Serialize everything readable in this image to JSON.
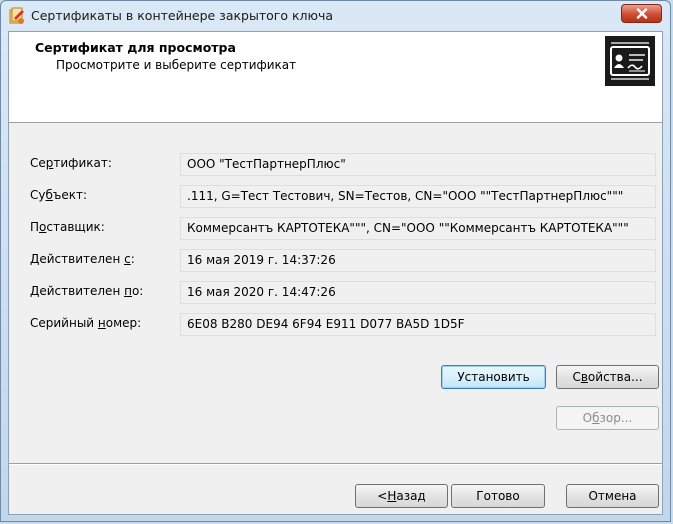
{
  "window": {
    "title": "Сертификаты в контейнере закрытого ключа"
  },
  "header": {
    "title": "Сертификат для просмотра",
    "subtitle": "Просмотрите и выберите сертификат"
  },
  "fields": [
    {
      "label_pre": "Се",
      "label_key": "р",
      "label_post": "тификат:",
      "value": "ООО \"ТестПартнерПлюс\""
    },
    {
      "label_pre": "Су",
      "label_key": "б",
      "label_post": "ъект:",
      "value": ".111, G=Тест Тестович, SN=Тестов, CN=\"ООО \"\"ТестПартнерПлюс\"\"\""
    },
    {
      "label_pre": "П",
      "label_key": "о",
      "label_post": "ставщик:",
      "value": "Коммерсантъ КАРТОТЕКА\"\"\", CN=\"ООО \"\"Коммерсантъ КАРТОТЕКА\"\"\""
    },
    {
      "label_pre": "Действителен ",
      "label_key": "с",
      "label_post": ":",
      "value": "16 мая 2019 г. 14:37:26"
    },
    {
      "label_pre": "Действителен ",
      "label_key": "п",
      "label_post": "о:",
      "value": "16 мая 2020 г. 14:47:26"
    },
    {
      "label_pre": "Серийный ",
      "label_key": "н",
      "label_post": "омер:",
      "value": "6E08 B280 DE94 6F94 E911 D077 BA5D 1D5F"
    }
  ],
  "buttons": {
    "install": "Установить",
    "properties_pre": "С",
    "properties_key": "в",
    "properties_post": "ойства...",
    "browse_pre": "О",
    "browse_key": "б",
    "browse_post": "зор...",
    "back_pre": "< ",
    "back_key": "Н",
    "back_post": "азад",
    "finish": "Готово",
    "cancel": "Отмена"
  }
}
